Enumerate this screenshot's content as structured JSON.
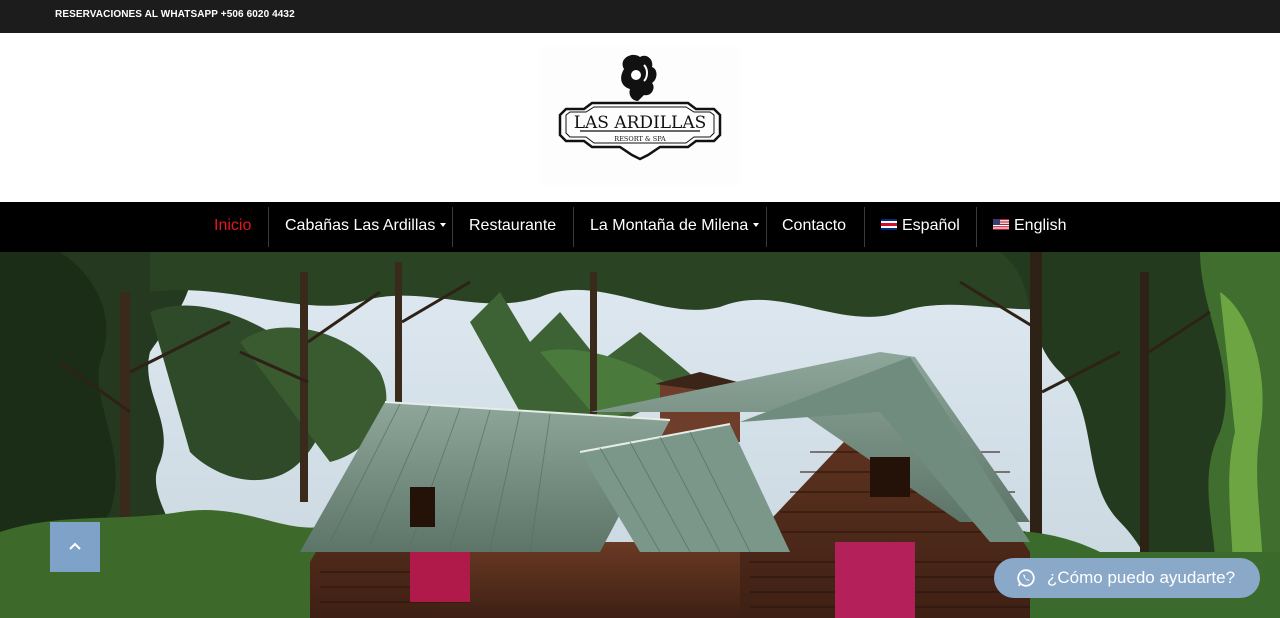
{
  "topbar": {
    "reservations_prefix": "RESERVACIONES AL WHATSAPP ",
    "phone": "+506 6020 4432"
  },
  "logo": {
    "name": "LAS ARDILLAS",
    "tagline": "RESORT & SPA"
  },
  "nav": {
    "items": [
      {
        "label": "Inicio",
        "active": true
      },
      {
        "label": "Cabañas Las Ardillas",
        "has_dropdown": true
      },
      {
        "label": "Restaurante"
      },
      {
        "label": "La Montaña de Milena",
        "has_dropdown": true
      },
      {
        "label": "Contacto"
      },
      {
        "label": "Español",
        "icon": "costa-rica-flag-icon"
      },
      {
        "label": "English",
        "icon": "us-flag-icon"
      }
    ]
  },
  "scroll_top": {
    "icon": "chevron-up-icon"
  },
  "help_chat": {
    "label": "¿Cómo puedo ayudarte?",
    "icon": "whatsapp-icon"
  },
  "colors": {
    "topbar_bg": "#1c1c1c",
    "nav_bg": "#000000",
    "active_link": "#e8141f",
    "scroll_top_bg": "#7fa3c8",
    "help_bg": "#8aa8c8"
  }
}
